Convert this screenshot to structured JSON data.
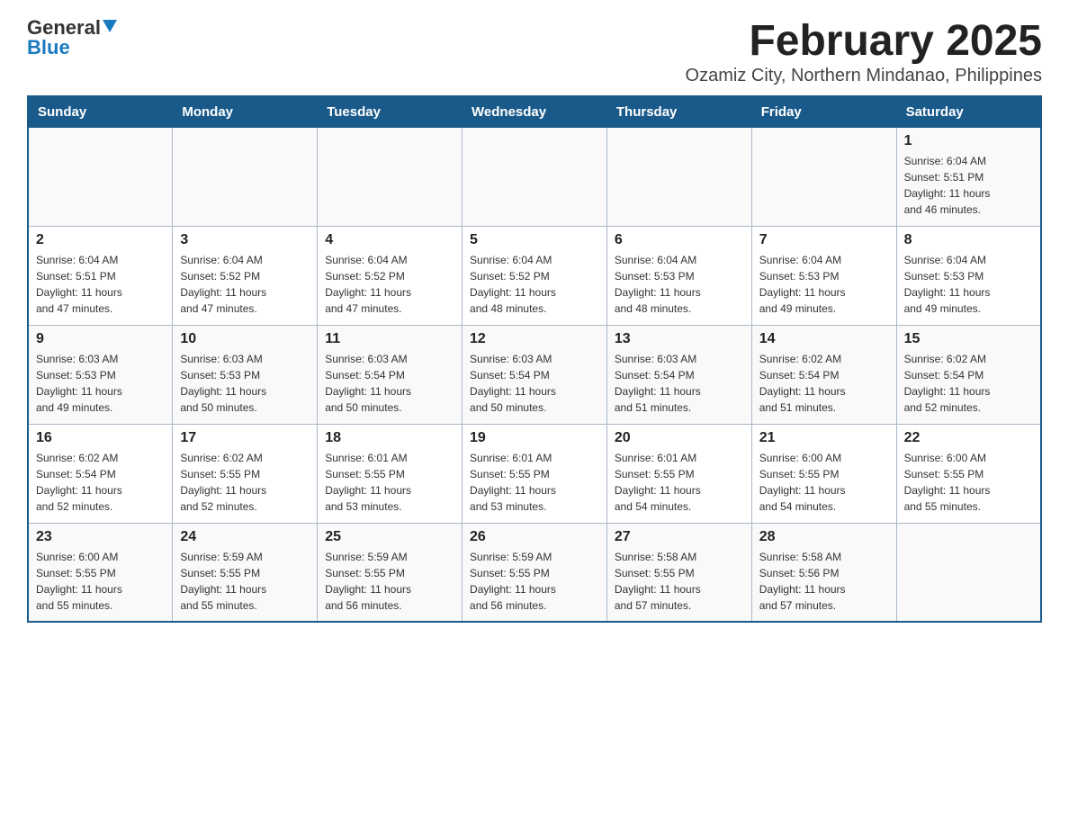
{
  "header": {
    "logo": {
      "general": "General",
      "blue": "Blue"
    },
    "title": "February 2025",
    "subtitle": "Ozamiz City, Northern Mindanao, Philippines"
  },
  "calendar": {
    "days": [
      "Sunday",
      "Monday",
      "Tuesday",
      "Wednesday",
      "Thursday",
      "Friday",
      "Saturday"
    ],
    "weeks": [
      [
        {
          "day": "",
          "info": ""
        },
        {
          "day": "",
          "info": ""
        },
        {
          "day": "",
          "info": ""
        },
        {
          "day": "",
          "info": ""
        },
        {
          "day": "",
          "info": ""
        },
        {
          "day": "",
          "info": ""
        },
        {
          "day": "1",
          "info": "Sunrise: 6:04 AM\nSunset: 5:51 PM\nDaylight: 11 hours\nand 46 minutes."
        }
      ],
      [
        {
          "day": "2",
          "info": "Sunrise: 6:04 AM\nSunset: 5:51 PM\nDaylight: 11 hours\nand 47 minutes."
        },
        {
          "day": "3",
          "info": "Sunrise: 6:04 AM\nSunset: 5:52 PM\nDaylight: 11 hours\nand 47 minutes."
        },
        {
          "day": "4",
          "info": "Sunrise: 6:04 AM\nSunset: 5:52 PM\nDaylight: 11 hours\nand 47 minutes."
        },
        {
          "day": "5",
          "info": "Sunrise: 6:04 AM\nSunset: 5:52 PM\nDaylight: 11 hours\nand 48 minutes."
        },
        {
          "day": "6",
          "info": "Sunrise: 6:04 AM\nSunset: 5:53 PM\nDaylight: 11 hours\nand 48 minutes."
        },
        {
          "day": "7",
          "info": "Sunrise: 6:04 AM\nSunset: 5:53 PM\nDaylight: 11 hours\nand 49 minutes."
        },
        {
          "day": "8",
          "info": "Sunrise: 6:04 AM\nSunset: 5:53 PM\nDaylight: 11 hours\nand 49 minutes."
        }
      ],
      [
        {
          "day": "9",
          "info": "Sunrise: 6:03 AM\nSunset: 5:53 PM\nDaylight: 11 hours\nand 49 minutes."
        },
        {
          "day": "10",
          "info": "Sunrise: 6:03 AM\nSunset: 5:53 PM\nDaylight: 11 hours\nand 50 minutes."
        },
        {
          "day": "11",
          "info": "Sunrise: 6:03 AM\nSunset: 5:54 PM\nDaylight: 11 hours\nand 50 minutes."
        },
        {
          "day": "12",
          "info": "Sunrise: 6:03 AM\nSunset: 5:54 PM\nDaylight: 11 hours\nand 50 minutes."
        },
        {
          "day": "13",
          "info": "Sunrise: 6:03 AM\nSunset: 5:54 PM\nDaylight: 11 hours\nand 51 minutes."
        },
        {
          "day": "14",
          "info": "Sunrise: 6:02 AM\nSunset: 5:54 PM\nDaylight: 11 hours\nand 51 minutes."
        },
        {
          "day": "15",
          "info": "Sunrise: 6:02 AM\nSunset: 5:54 PM\nDaylight: 11 hours\nand 52 minutes."
        }
      ],
      [
        {
          "day": "16",
          "info": "Sunrise: 6:02 AM\nSunset: 5:54 PM\nDaylight: 11 hours\nand 52 minutes."
        },
        {
          "day": "17",
          "info": "Sunrise: 6:02 AM\nSunset: 5:55 PM\nDaylight: 11 hours\nand 52 minutes."
        },
        {
          "day": "18",
          "info": "Sunrise: 6:01 AM\nSunset: 5:55 PM\nDaylight: 11 hours\nand 53 minutes."
        },
        {
          "day": "19",
          "info": "Sunrise: 6:01 AM\nSunset: 5:55 PM\nDaylight: 11 hours\nand 53 minutes."
        },
        {
          "day": "20",
          "info": "Sunrise: 6:01 AM\nSunset: 5:55 PM\nDaylight: 11 hours\nand 54 minutes."
        },
        {
          "day": "21",
          "info": "Sunrise: 6:00 AM\nSunset: 5:55 PM\nDaylight: 11 hours\nand 54 minutes."
        },
        {
          "day": "22",
          "info": "Sunrise: 6:00 AM\nSunset: 5:55 PM\nDaylight: 11 hours\nand 55 minutes."
        }
      ],
      [
        {
          "day": "23",
          "info": "Sunrise: 6:00 AM\nSunset: 5:55 PM\nDaylight: 11 hours\nand 55 minutes."
        },
        {
          "day": "24",
          "info": "Sunrise: 5:59 AM\nSunset: 5:55 PM\nDaylight: 11 hours\nand 55 minutes."
        },
        {
          "day": "25",
          "info": "Sunrise: 5:59 AM\nSunset: 5:55 PM\nDaylight: 11 hours\nand 56 minutes."
        },
        {
          "day": "26",
          "info": "Sunrise: 5:59 AM\nSunset: 5:55 PM\nDaylight: 11 hours\nand 56 minutes."
        },
        {
          "day": "27",
          "info": "Sunrise: 5:58 AM\nSunset: 5:55 PM\nDaylight: 11 hours\nand 57 minutes."
        },
        {
          "day": "28",
          "info": "Sunrise: 5:58 AM\nSunset: 5:56 PM\nDaylight: 11 hours\nand 57 minutes."
        },
        {
          "day": "",
          "info": ""
        }
      ]
    ]
  }
}
